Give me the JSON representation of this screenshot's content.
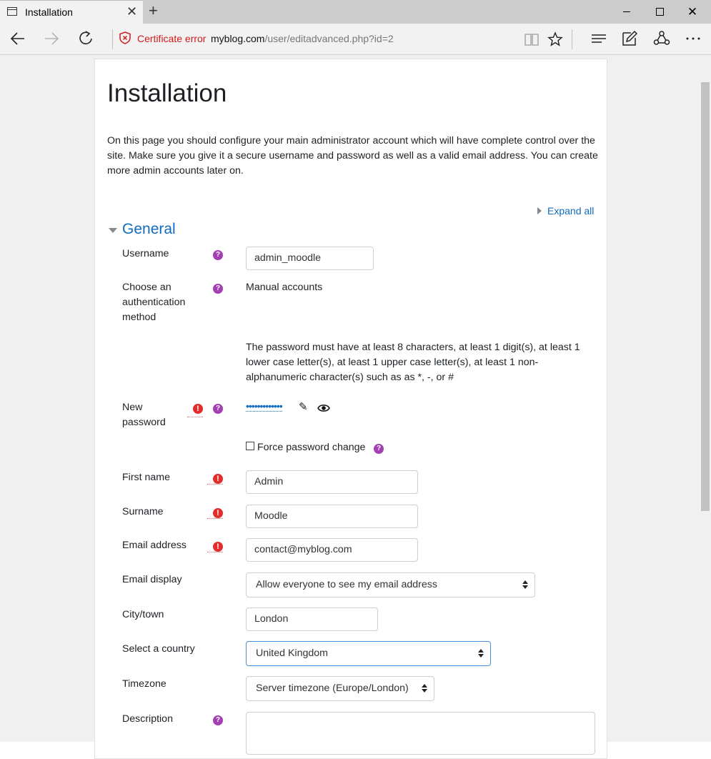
{
  "browser": {
    "tab_title": "Installation",
    "tab_close": "✕",
    "new_tab": "+",
    "win_close": "✕",
    "cert_error": "Certificate error",
    "url_host": "myblog.com",
    "url_path": "/user/editadvanced.php?id=2",
    "icons": [
      "back-arrow-icon",
      "forward-arrow-icon",
      "refresh-icon",
      "shield-x-icon",
      "reading-view-icon",
      "star-icon",
      "hub-icon",
      "web-note-icon",
      "share-icon",
      "more-icon"
    ]
  },
  "page": {
    "title": "Installation",
    "intro": "On this page you should configure your main administrator account which will have complete control over the site. Make sure you give it a secure username and password as well as a valid email address. You can create more admin accounts later on.",
    "expand_all": "Expand all",
    "section_general": "General"
  },
  "form": {
    "username": {
      "label": "Username",
      "value": "admin_moodle"
    },
    "auth": {
      "label": "Choose an authentication method",
      "value": "Manual accounts"
    },
    "password_rules": "The password must have at least 8 characters, at least 1 digit(s), at least 1 lower case letter(s), at least 1 upper case letter(s), at least 1 non-alphanumeric character(s) such as as *, -, or #",
    "new_password": {
      "label": "New password",
      "masked": "•••••••••••••"
    },
    "force_change": {
      "label": "Force password change",
      "checked": false
    },
    "first_name": {
      "label": "First name",
      "value": "Admin"
    },
    "surname": {
      "label": "Surname",
      "value": "Moodle"
    },
    "email": {
      "label": "Email address",
      "value": "contact@myblog.com"
    },
    "email_display": {
      "label": "Email display",
      "value": "Allow everyone to see my email address"
    },
    "city": {
      "label": "City/town",
      "value": "London"
    },
    "country": {
      "label": "Select a country",
      "value": "United Kingdom"
    },
    "timezone": {
      "label": "Timezone",
      "value": "Server timezone (Europe/London)"
    },
    "description": {
      "label": "Description"
    }
  },
  "glyphs": {
    "help": "?",
    "required": "!",
    "pencil": "✎",
    "eye": "👁"
  },
  "colors": {
    "link": "#0f6cbf",
    "help_badge": "#a33fb3",
    "required_badge": "#e22d2d",
    "cert_error": "#d21a1a"
  }
}
